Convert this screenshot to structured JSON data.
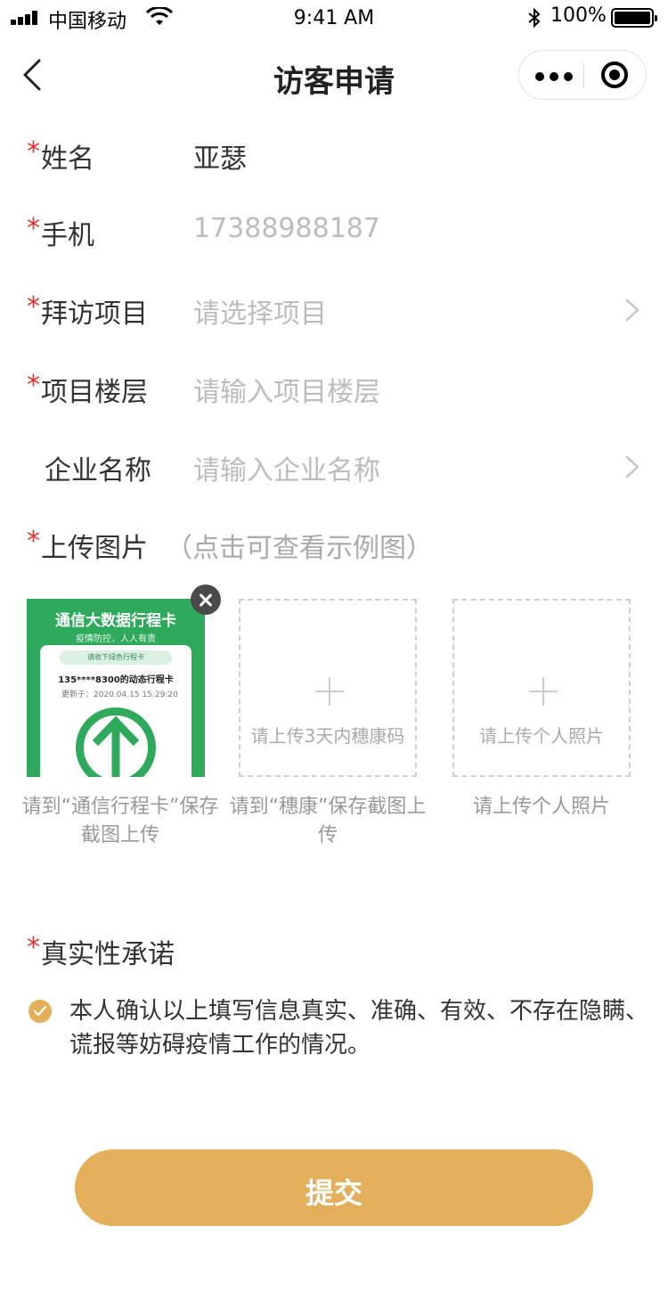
{
  "status_bar": {
    "carrier": "中国移动",
    "time": "9:41 AM",
    "battery": "100%",
    "icons": [
      "signal-icon",
      "wifi-icon",
      "bluetooth-icon",
      "battery-icon"
    ]
  },
  "nav": {
    "title": "访客申请",
    "back_icon": "chevron-left-icon",
    "menu_icon": "more-dots-icon",
    "close_icon": "target-close-icon"
  },
  "form": {
    "required_mark": "*",
    "name": {
      "label": "姓名",
      "value": "亚瑟"
    },
    "phone": {
      "label": "手机",
      "value": "17388988187"
    },
    "project": {
      "label": "拜访项目",
      "placeholder": "请选择项目"
    },
    "floor": {
      "label": "项目楼层",
      "placeholder": "请输入项目楼层"
    },
    "company": {
      "label": "企业名称",
      "placeholder": "请输入企业名称"
    }
  },
  "upload": {
    "label": "上传图片",
    "hint": "（点击可查看示例图）",
    "slots": [
      {
        "caption": "请到“通信行程卡”保存截图上传",
        "thumb": {
          "title": "通信大数据行程卡",
          "subtitle": "疫情防控，人人有责",
          "pill": "请收下绿色行程卡",
          "number": "135****8300的动态行程卡",
          "updated": "更新于：2020.04.15 15:29:20"
        }
      },
      {
        "text": "请上传3天内穗康码",
        "caption": "请到“穗康”保存截图上传"
      },
      {
        "text": "请上传个人照片",
        "caption": "请上传个人照片"
      }
    ]
  },
  "commitment": {
    "label": "真实性承诺",
    "text": "本人确认以上填写信息真实、准确、有效、不存在隐瞒、谎报等妨碍疫情工作的情况。",
    "checked": true
  },
  "submit_label": "提交",
  "colors": {
    "accent": "#e3af5a",
    "required": "#e7312c",
    "placeholder": "#bcbcbc",
    "card_green": "#2faa5c"
  }
}
